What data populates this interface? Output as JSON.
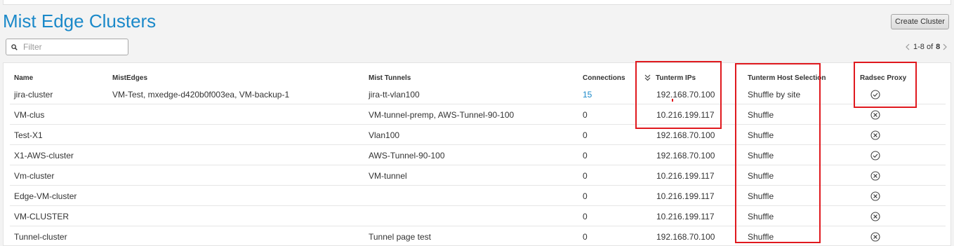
{
  "page": {
    "title": "Mist Edge Clusters",
    "create_button_label": "Create Cluster"
  },
  "filter": {
    "placeholder": "Filter",
    "value": ""
  },
  "pagination": {
    "range": "1-8 of",
    "total": "8"
  },
  "table": {
    "columns": {
      "name": "Name",
      "mistedges": "MistEdges",
      "mist_tunnels": "Mist Tunnels",
      "connections": "Connections",
      "tunterm_ips": "Tunterm IPs",
      "tunterm_host_selection": "Tunterm Host Selection",
      "radsec_proxy": "Radsec Proxy"
    },
    "sorted_column": "tunterm_ips",
    "rows": [
      {
        "name": "jira-cluster",
        "mistedges": "VM-Test, mxedge-d420b0f003ea, VM-backup-1",
        "mist_tunnels": "jira-tt-vlan100",
        "connections": "15",
        "tunterm_ips": "192.168.70.100",
        "host_selection": "Shuffle by site",
        "radsec": "check-circle-icon"
      },
      {
        "name": "VM-clus",
        "mistedges": "",
        "mist_tunnels": "VM-tunnel-premp, AWS-Tunnel-90-100",
        "connections": "0",
        "tunterm_ips": "10.216.199.117",
        "host_selection": "Shuffle",
        "radsec": "x-circle-icon"
      },
      {
        "name": "Test-X1",
        "mistedges": "",
        "mist_tunnels": "Vlan100",
        "connections": "0",
        "tunterm_ips": "192.168.70.100",
        "host_selection": "Shuffle",
        "radsec": "x-circle-icon"
      },
      {
        "name": "X1-AWS-cluster",
        "mistedges": "",
        "mist_tunnels": "AWS-Tunnel-90-100",
        "connections": "0",
        "tunterm_ips": "192.168.70.100",
        "host_selection": "Shuffle",
        "radsec": "check-circle-icon"
      },
      {
        "name": "Vm-cluster",
        "mistedges": "",
        "mist_tunnels": "VM-tunnel",
        "connections": "0",
        "tunterm_ips": "10.216.199.117",
        "host_selection": "Shuffle",
        "radsec": "x-circle-icon"
      },
      {
        "name": "Edge-VM-cluster",
        "mistedges": "",
        "mist_tunnels": "",
        "connections": "0",
        "tunterm_ips": "10.216.199.117",
        "host_selection": "Shuffle",
        "radsec": "x-circle-icon"
      },
      {
        "name": "VM-CLUSTER",
        "mistedges": "",
        "mist_tunnels": "",
        "connections": "0",
        "tunterm_ips": "10.216.199.117",
        "host_selection": "Shuffle",
        "radsec": "x-circle-icon"
      },
      {
        "name": "Tunnel-cluster",
        "mistedges": "",
        "mist_tunnels": "Tunnel page test",
        "connections": "0",
        "tunterm_ips": "192.168.70.100",
        "host_selection": "Shuffle",
        "radsec": "x-circle-icon"
      }
    ]
  },
  "annotations": {
    "highlight_color": "#e0191e",
    "link_color": "#1b89c9"
  }
}
